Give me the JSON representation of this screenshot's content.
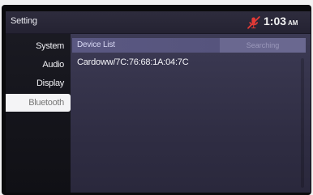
{
  "screen": {
    "title": "Setting",
    "clock": {
      "time": "1:03",
      "ampm": "AM"
    },
    "mic_icon": "microphone-muted-icon"
  },
  "sidebar": {
    "items": [
      {
        "label": "System",
        "active": false
      },
      {
        "label": "Audio",
        "active": false
      },
      {
        "label": "Display",
        "active": false
      },
      {
        "label": "Bluetooth",
        "active": true
      }
    ]
  },
  "main": {
    "list_title": "Device List",
    "searching_label": "Searching",
    "devices": [
      {
        "name": "Cardoww/7C:76:68:1A:04:7C"
      }
    ]
  },
  "colors": {
    "accent": "#5a5882",
    "muted_mic": "#e23a36",
    "active_tab_bg": "#f4f4f6"
  }
}
